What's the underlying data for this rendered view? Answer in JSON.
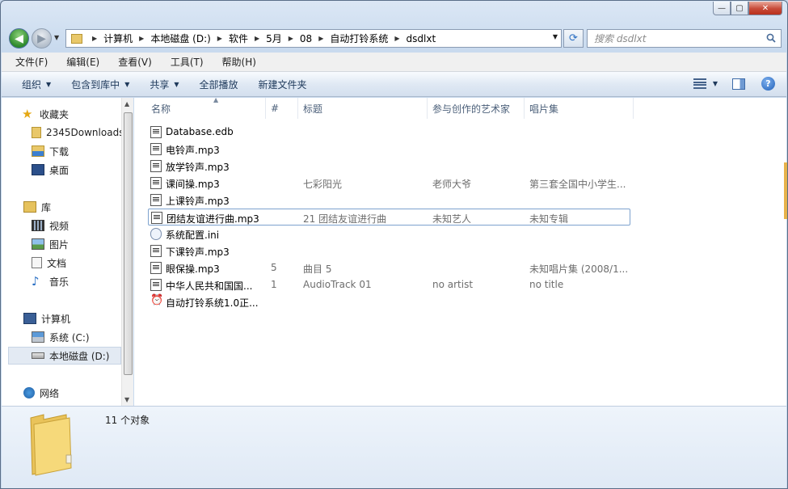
{
  "window": {
    "caption": {
      "minimize": "—",
      "maximize": "▢",
      "close": "✕"
    }
  },
  "address": {
    "crumbs": [
      "计算机",
      "本地磁盘 (D:)",
      "软件",
      "5月",
      "08",
      "自动打铃系统",
      "dsdlxt"
    ],
    "search_placeholder": "搜索 dsdlxt"
  },
  "menubar": [
    "文件(F)",
    "编辑(E)",
    "查看(V)",
    "工具(T)",
    "帮助(H)"
  ],
  "commandbar": {
    "organize": "组织",
    "include_in_library": "包含到库中",
    "share": "共享",
    "play_all": "全部播放",
    "new_folder": "新建文件夹"
  },
  "navpane": {
    "favorites": {
      "label": "收藏夹",
      "items": [
        "2345Downloads",
        "下载",
        "桌面"
      ]
    },
    "libraries": {
      "label": "库",
      "items": [
        "视频",
        "图片",
        "文档",
        "音乐"
      ]
    },
    "computer": {
      "label": "计算机",
      "items": [
        "系统 (C:)",
        "本地磁盘 (D:)"
      ]
    },
    "network": {
      "label": "网络"
    }
  },
  "columns": {
    "name": "名称",
    "number": "#",
    "title": "标题",
    "artist": "参与创作的艺术家",
    "album": "唱片集"
  },
  "files": [
    {
      "name": "Database.edb",
      "number": "",
      "title": "",
      "artist": "",
      "album": "",
      "icon": "document-icon"
    },
    {
      "name": "电铃声.mp3",
      "number": "",
      "title": "",
      "artist": "",
      "album": "",
      "icon": "audio-file-icon"
    },
    {
      "name": "放学铃声.mp3",
      "number": "",
      "title": "",
      "artist": "",
      "album": "",
      "icon": "audio-file-icon"
    },
    {
      "name": "课间操.mp3",
      "number": "",
      "title": "七彩阳光",
      "artist": "老师大爷",
      "album": "第三套全国中小学生...",
      "icon": "audio-file-icon"
    },
    {
      "name": "上课铃声.mp3",
      "number": "",
      "title": "",
      "artist": "",
      "album": "",
      "icon": "audio-file-icon"
    },
    {
      "name": "团结友谊进行曲.mp3",
      "number": "",
      "title": "21 团结友谊进行曲",
      "artist": "未知艺人",
      "album": "未知专辑",
      "icon": "audio-file-icon"
    },
    {
      "name": "系统配置.ini",
      "number": "",
      "title": "",
      "artist": "",
      "album": "",
      "icon": "settings-file-icon"
    },
    {
      "name": "下课铃声.mp3",
      "number": "",
      "title": "",
      "artist": "",
      "album": "",
      "icon": "audio-file-icon"
    },
    {
      "name": "眼保操.mp3",
      "number": "5",
      "title": "曲目 5",
      "artist": "",
      "album": "未知唱片集 (2008/1...",
      "icon": "audio-file-icon"
    },
    {
      "name": "中华人民共和国国...",
      "number": "1",
      "title": "AudioTrack 01",
      "artist": "no artist",
      "album": "no title",
      "icon": "audio-file-icon"
    },
    {
      "name": "自动打铃系统1.0正...",
      "number": "",
      "title": "",
      "artist": "",
      "album": "",
      "icon": "app-icon"
    }
  ],
  "status": {
    "count_text": "11 个对象"
  }
}
